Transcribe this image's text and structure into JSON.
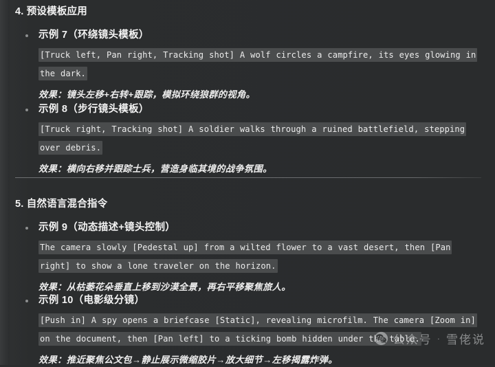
{
  "sections": [
    {
      "heading": "4. 预设模板应用",
      "examples": [
        {
          "title": "示例 7（环绕镜头模板）",
          "code": "[Truck left, Pan right, Tracking shot] A wolf circles a campfire, its eyes glowing in the dark.",
          "effect": "效果：镜头左移+右转+跟踪，模拟环绕狼群的视角。"
        },
        {
          "title": "示例 8（步行镜头模板）",
          "code": "[Truck right, Tracking shot] A soldier walks through a ruined battlefield, stepping over debris.",
          "effect": "效果：横向右移并跟踪士兵，营造身临其境的战争氛围。"
        }
      ]
    },
    {
      "heading": "5. 自然语言混合指令",
      "examples": [
        {
          "title": "示例 9（动态描述+镜头控制）",
          "code": "The camera slowly [Pedestal up] from a wilted flower to a vast desert, then [Pan right] to show a lone traveler on the horizon.",
          "effect": "效果：从枯萎花朵垂直上移到沙漠全景，再右平移聚焦旅人。"
        },
        {
          "title": "示例 10（电影级分镜）",
          "code": "[Push in] A spy opens a briefcase [Static], revealing microfilm. The camera [Zoom in] on the document, then [Pan left] to a ticking bomb hidden under the table.",
          "effect": "效果：推近聚焦公文包→静止展示微缩胶片→放大细节→左移揭露炸弹。"
        }
      ]
    }
  ],
  "watermark": {
    "icon": "wechat-icon",
    "separator": "·",
    "label_prefix": "公众号",
    "label_name": "雪佬说"
  },
  "colors": {
    "page_background": "#2b2d2e",
    "text": "#ececec",
    "code_highlight": "#4a4c4d",
    "divider": "#6e7072",
    "bullet": "#8d8f90"
  }
}
